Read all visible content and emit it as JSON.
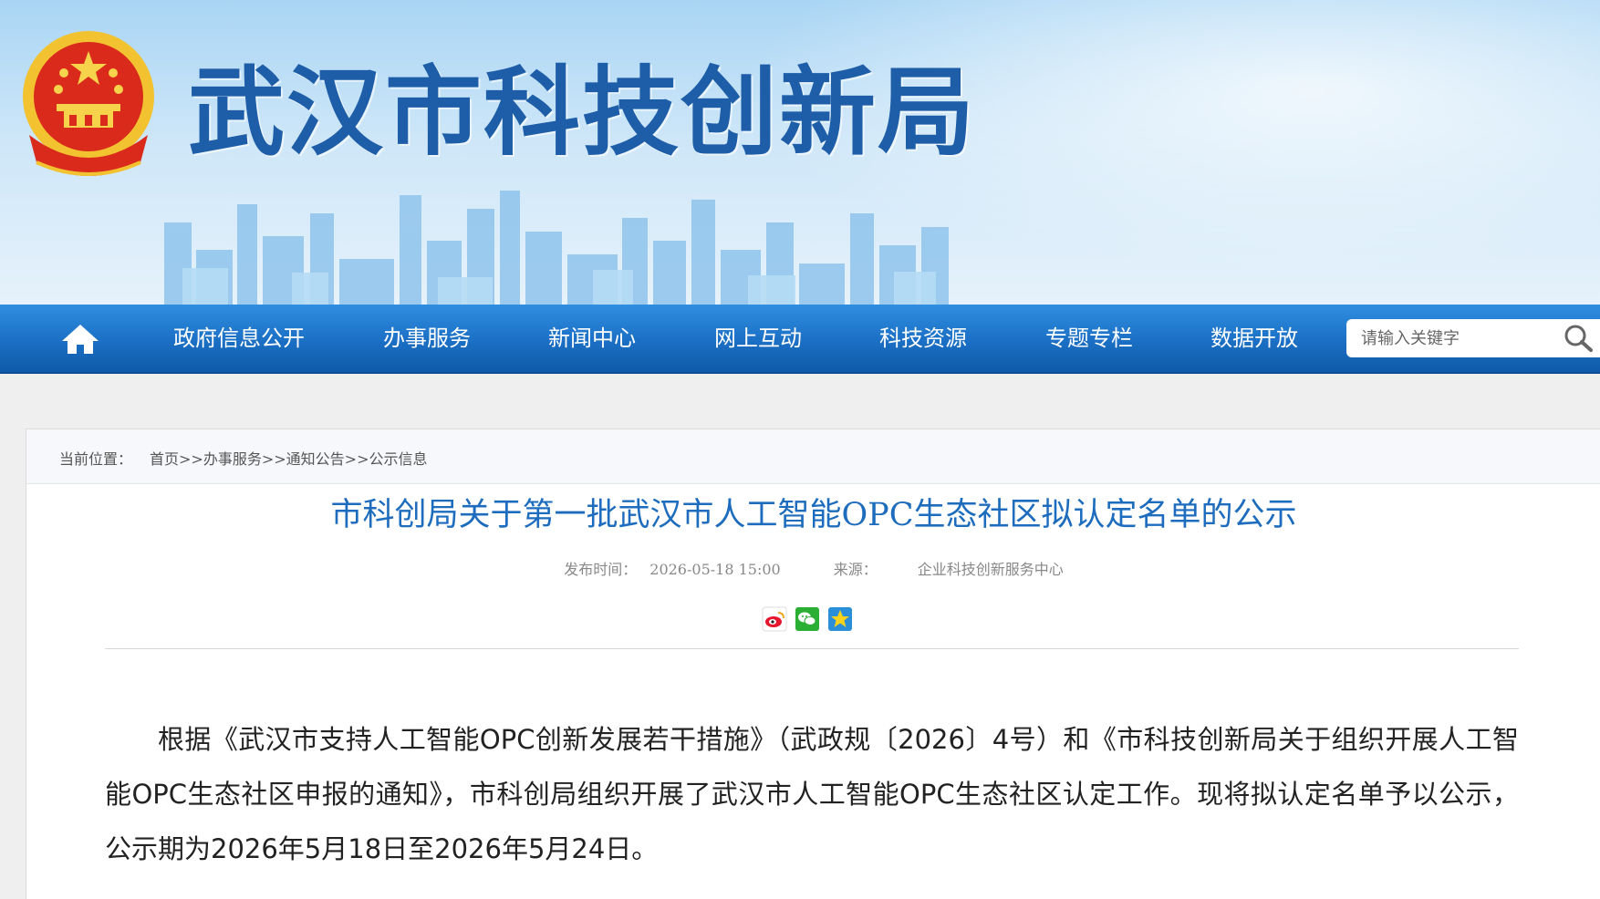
{
  "header": {
    "site_title": "武汉市科技创新局",
    "emblem_icon": "national-emblem-icon"
  },
  "nav": {
    "home_icon": "home-icon",
    "items": [
      {
        "label": "政府信息公开"
      },
      {
        "label": "办事服务"
      },
      {
        "label": "新闻中心"
      },
      {
        "label": "网上互动"
      },
      {
        "label": "科技资源"
      },
      {
        "label": "专题专栏"
      },
      {
        "label": "数据开放"
      }
    ],
    "search_placeholder": "请输入关键字",
    "search_icon": "search-icon"
  },
  "breadcrumb": {
    "label": "当前位置：",
    "items": [
      "首页",
      "办事服务",
      "通知公告",
      "公示信息"
    ],
    "separator": ">>"
  },
  "article": {
    "title": "市科创局关于第一批武汉市人工智能OPC生态社区拟认定名单的公示",
    "publish_label": "发布时间：",
    "publish_time": "2026-05-18 15:00",
    "source_label": "来源：",
    "source": "企业科技创新服务中心",
    "share_icons": [
      "weibo-icon",
      "wechat-icon",
      "qzone-icon"
    ],
    "paragraphs": [
      "根据《武汉市支持人工智能OPC创新发展若干措施》（武政规〔2026〕4号）和《市科技创新局关于组织开展人工智能OPC生态社区申报的通知》，市科创局组织开展了武汉市人工智能OPC生态社区认定工作。现将拟认定名单予以公示，公示期为2026年5月18日至2026年5月24日。"
    ]
  },
  "colors": {
    "nav_bg": "#1b6fc4",
    "title_blue": "#1d6cbd",
    "site_title_blue": "#1e5ea8"
  }
}
